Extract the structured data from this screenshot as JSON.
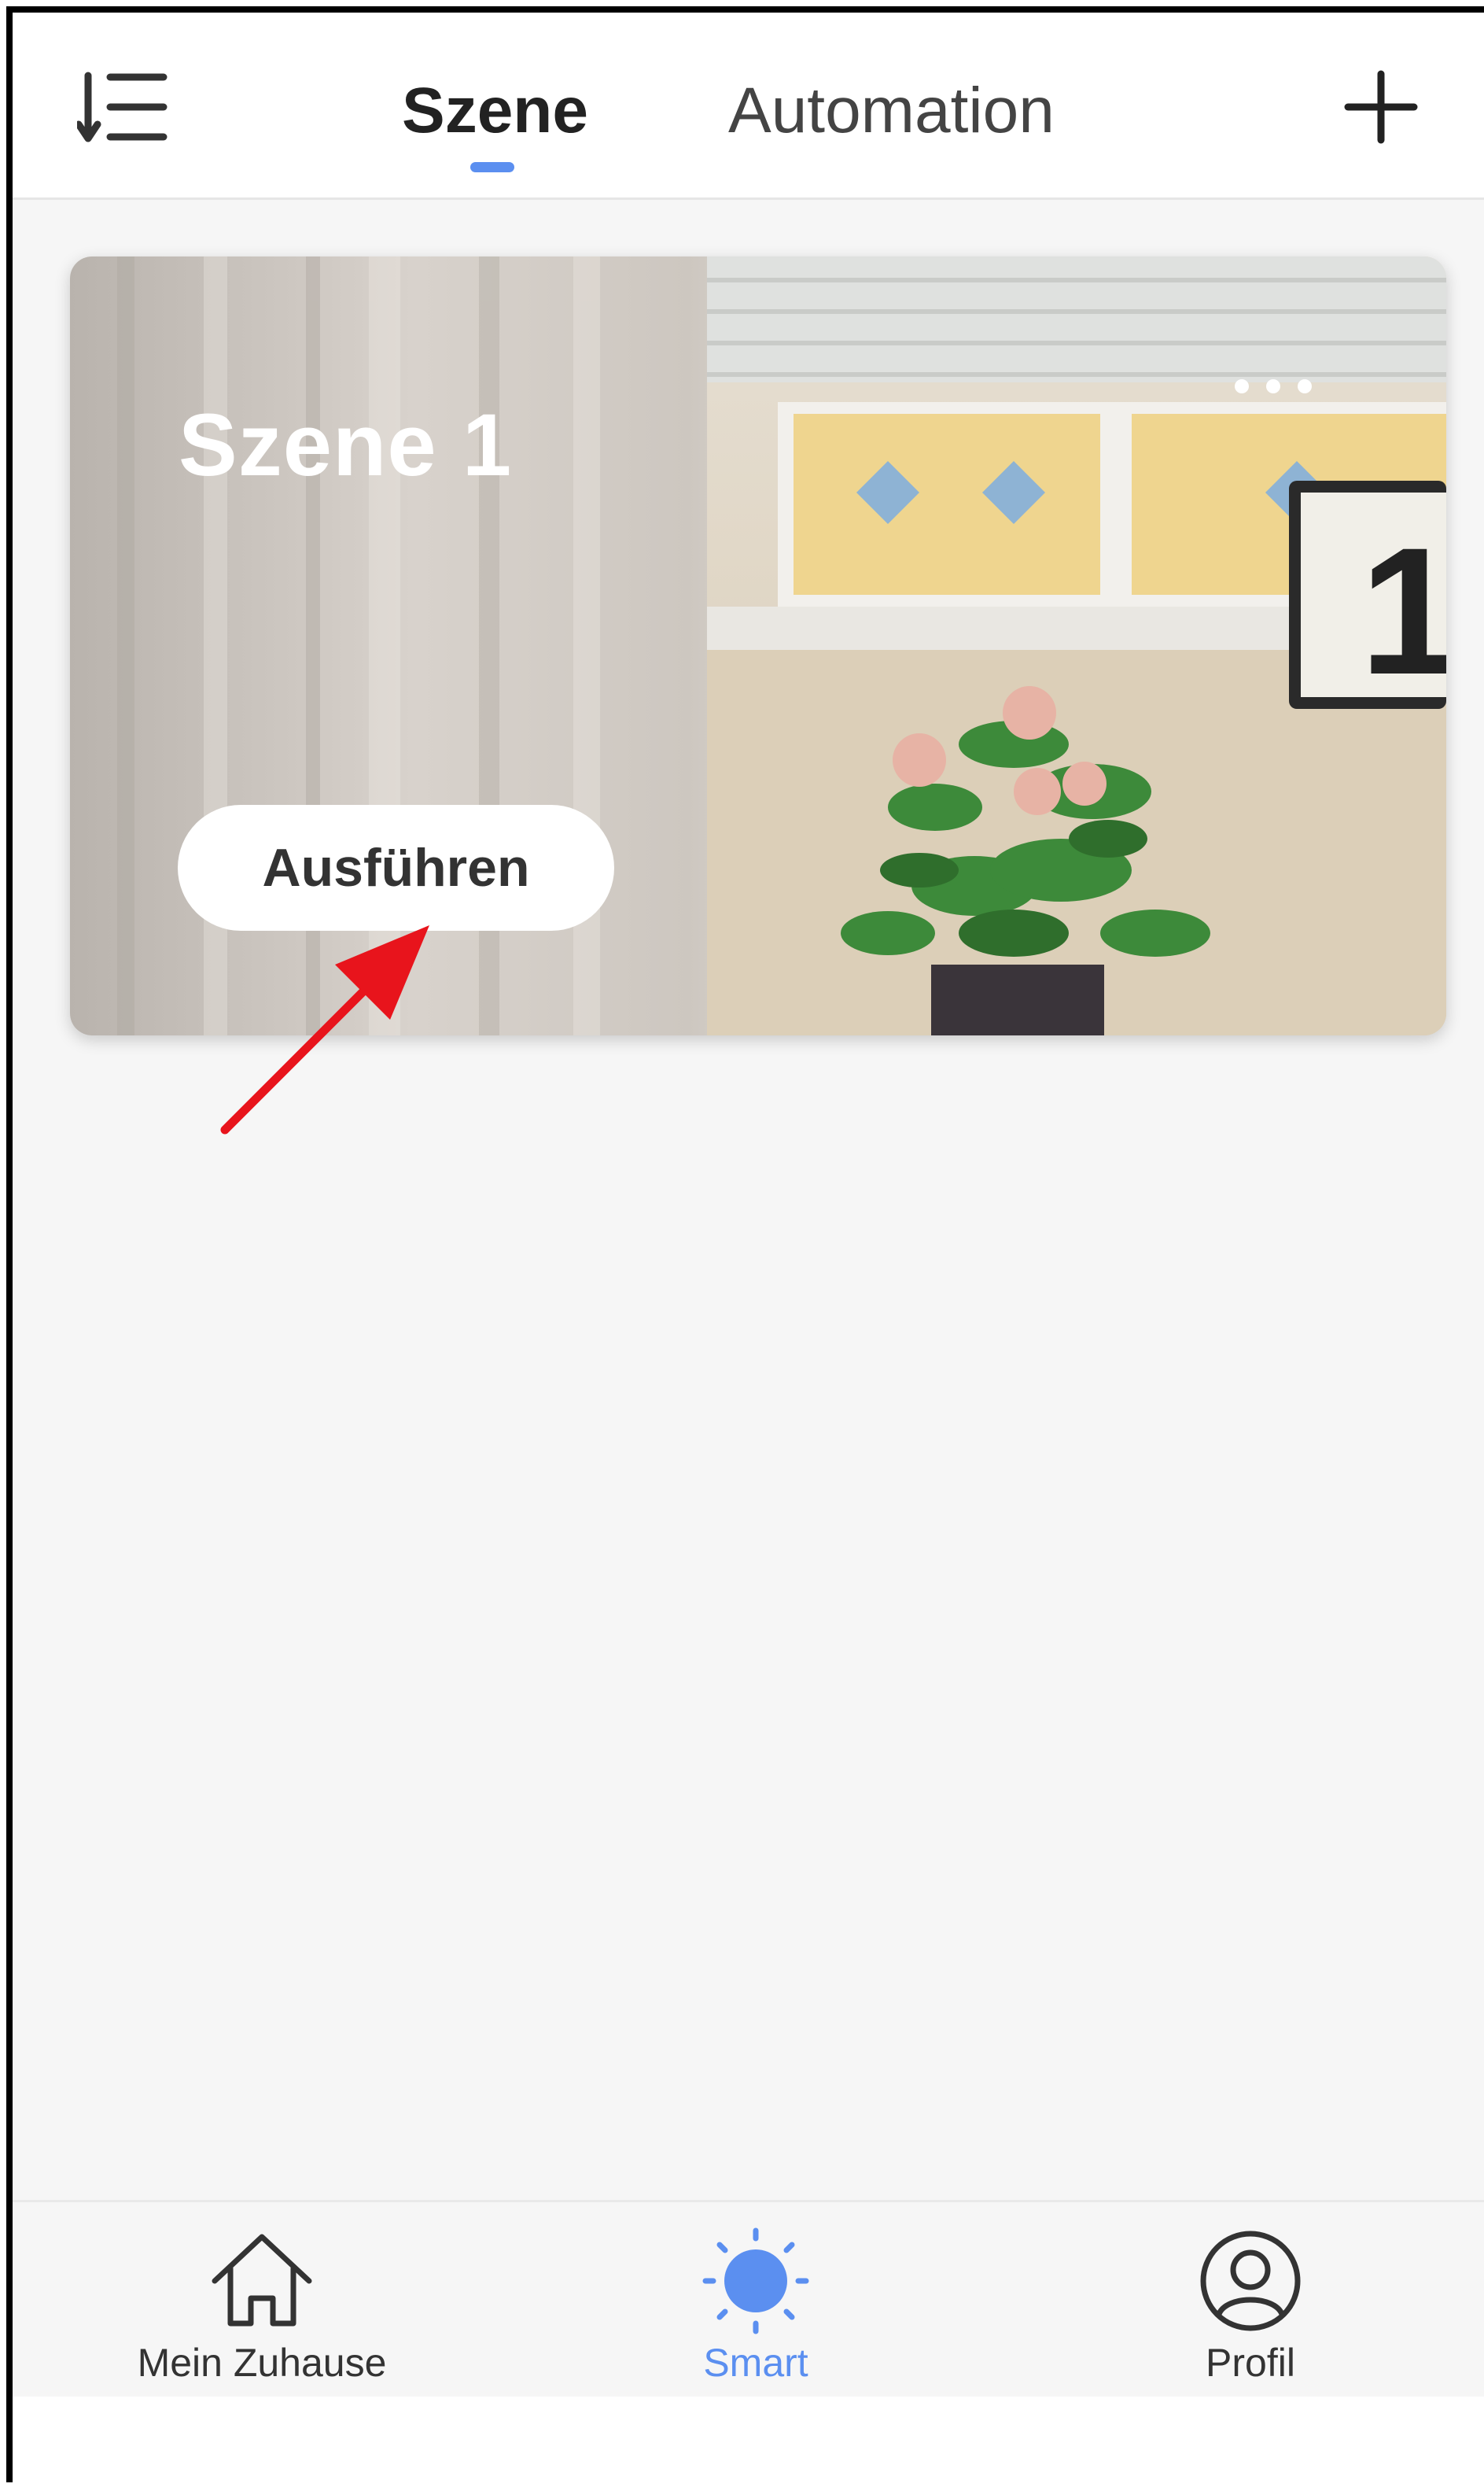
{
  "header": {
    "sort_icon": "sort-list-icon",
    "tabs": [
      {
        "label": "Szene",
        "active": true
      },
      {
        "label": "Automation",
        "active": false
      }
    ],
    "add_icon": "plus-icon",
    "accent_color": "#5b8ff0"
  },
  "scene_card": {
    "title": "Szene 1",
    "more_icon": "more-dots-icon",
    "run_button_label": "Ausführen"
  },
  "annotation": {
    "arrow_color": "#e8141c"
  },
  "bottom_nav": {
    "items": [
      {
        "label": "Mein Zuhause",
        "icon": "home-icon",
        "active": false
      },
      {
        "label": "Smart",
        "icon": "sun-icon",
        "active": true
      },
      {
        "label": "Profil",
        "icon": "profile-icon",
        "active": false
      }
    ]
  }
}
